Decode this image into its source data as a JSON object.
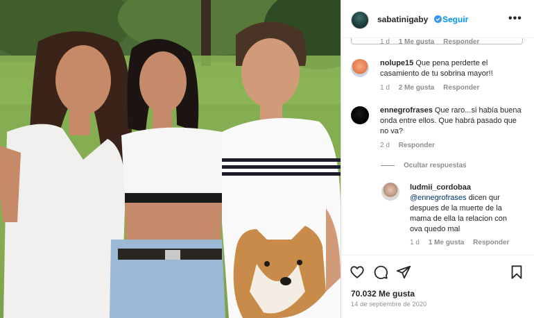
{
  "post": {
    "username": "sabatinigaby",
    "follow_label": "Seguir",
    "more_label": "•••",
    "likes": "70.032 Me gusta",
    "date": "14 de septiembre de 2020"
  },
  "cut_comment": {
    "time": "1 d",
    "likes": "1 Me gusta",
    "reply_label": "Responder"
  },
  "comments": [
    {
      "user": "nolupe15",
      "text": "Que pena perderte el casamiento de tu sobrina mayor!!",
      "time": "1 d",
      "likes": "2 Me gusta",
      "reply_label": "Responder"
    },
    {
      "user": "ennegrofrases",
      "text": "Que raro...si había buena onda entre ellos. Que habrá pasado que no va?",
      "time": "2 d",
      "reply_label": "Responder",
      "hide_replies_label": "Ocultar respuestas"
    }
  ],
  "reply": {
    "user": "ludmii_cordobaa",
    "mention": "@ennegrofrases",
    "text": "dicen qur despues de la muerte de la mama de ella la relacion con ova quedo mal",
    "time": "1 d",
    "likes": "1 Me gusta",
    "reply_label": "Responder"
  },
  "icons": {
    "like": "heart-icon",
    "comment": "comment-icon",
    "share": "paper-plane-icon",
    "save": "bookmark-icon",
    "verified": "verified-badge-icon"
  },
  "colors": {
    "accent": "#0095f6",
    "verified": "#3897f0",
    "muted": "#8e8e8e",
    "text": "#262626"
  }
}
